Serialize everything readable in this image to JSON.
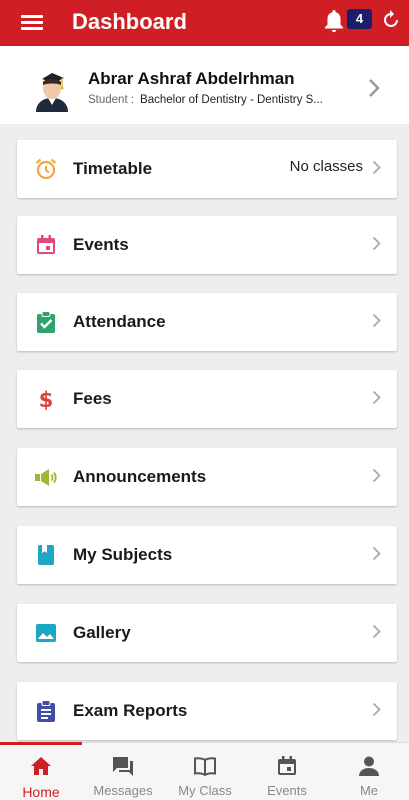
{
  "header": {
    "title": "Dashboard",
    "notification_count": "4",
    "brand_color": "#cf1f25",
    "icons": [
      "menu-icon",
      "bell-icon",
      "refresh-icon"
    ]
  },
  "profile": {
    "name": "Abrar Ashraf Abdelrhman",
    "role": "Student :",
    "program": "Bachelor of Dentistry - Dentistry S..."
  },
  "menu": [
    {
      "label": "Timetable",
      "extra": "No classes",
      "icon": "alarm-clock-icon",
      "color": "#f2a93b"
    },
    {
      "label": "Events",
      "extra": "",
      "icon": "calendar-icon",
      "color": "#e0487f"
    },
    {
      "label": "Attendance",
      "extra": "",
      "icon": "clipboard-check-icon",
      "color": "#2fa36b"
    },
    {
      "label": "Fees",
      "extra": "",
      "icon": "dollar-icon",
      "color": "#d9433a"
    },
    {
      "label": "Announcements",
      "extra": "",
      "icon": "megaphone-icon",
      "color": "#9bb734"
    },
    {
      "label": "My Subjects",
      "extra": "",
      "icon": "book-icon",
      "color": "#1ea7c4"
    },
    {
      "label": "Gallery",
      "extra": "",
      "icon": "image-icon",
      "color": "#1ea7c4"
    },
    {
      "label": "Exam Reports",
      "extra": "",
      "icon": "report-icon",
      "color": "#3f4fa8"
    }
  ],
  "bottom_nav": [
    {
      "label": "Home",
      "icon": "home-icon",
      "active": true
    },
    {
      "label": "Messages",
      "icon": "chat-icon",
      "active": false
    },
    {
      "label": "My Class",
      "icon": "open-book-icon",
      "active": false
    },
    {
      "label": "Events",
      "icon": "calendar-icon",
      "active": false
    },
    {
      "label": "Me",
      "icon": "person-icon",
      "active": false
    }
  ]
}
